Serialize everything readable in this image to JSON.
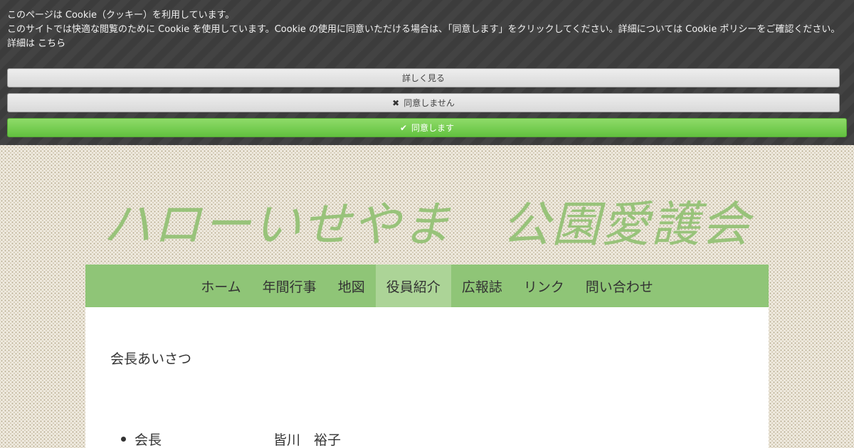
{
  "cookie_banner": {
    "title": "このページは Cookie（クッキー）を利用しています。",
    "message": "このサイトでは快適な閲覧のために Cookie を使用しています。Cookie の使用に同意いただける場合は、「同意します」をクリックしてください。詳細については Cookie ポリシーをご確認ください。",
    "details_prefix": "詳細は",
    "details_link": "こちら",
    "details_button": "詳しく見る",
    "decline_button": "同意しません",
    "accept_button": "同意します",
    "decline_icon": "close-icon",
    "accept_icon": "check-icon"
  },
  "site": {
    "title": "ハローいせやま　公園愛護会",
    "title_color": "#98c37a",
    "nav_color": "#8fc577",
    "nav_active_color": "#acd497"
  },
  "nav": {
    "items": [
      {
        "label": "ホーム",
        "active": false
      },
      {
        "label": "年間行事",
        "active": false
      },
      {
        "label": "地図",
        "active": false
      },
      {
        "label": "役員紹介",
        "active": true
      },
      {
        "label": "広報誌",
        "active": false
      },
      {
        "label": "リンク",
        "active": false
      },
      {
        "label": "問い合わせ",
        "active": false
      }
    ]
  },
  "content": {
    "heading": "会長あいさつ",
    "officers": [
      {
        "role": "会長",
        "name": "皆川　裕子"
      }
    ]
  }
}
